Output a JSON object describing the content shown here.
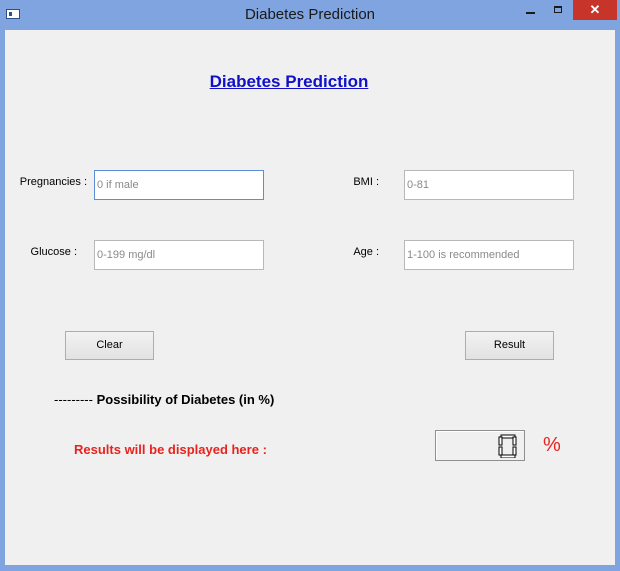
{
  "window": {
    "title": "Diabetes Prediction",
    "controls": {
      "minimize": "",
      "maximize": "",
      "close": "✕"
    }
  },
  "form": {
    "heading": "Diabetes Prediction",
    "fields": {
      "pregnancies": {
        "label": "Pregnancies :",
        "placeholder": "0 if male",
        "value": ""
      },
      "glucose": {
        "label": "Glucose :",
        "placeholder": "0-199 mg/dl",
        "value": ""
      },
      "bmi": {
        "label": "BMI :",
        "placeholder": "0-81",
        "value": ""
      },
      "age": {
        "label": "Age :",
        "placeholder": "1-100 is recommended",
        "value": ""
      }
    },
    "buttons": {
      "clear": "Clear",
      "result": "Result"
    }
  },
  "output": {
    "caption_dashes": "---------",
    "caption": "Possibility of Diabetes (in %)",
    "results_label": "Results will be displayed here :",
    "lcd_value": 0,
    "percent_sign": "%"
  },
  "colors": {
    "titlebar": "#7fa4e0",
    "heading_link": "#1010c8",
    "alert_red": "#e8231e",
    "close_button": "#c7352a"
  }
}
